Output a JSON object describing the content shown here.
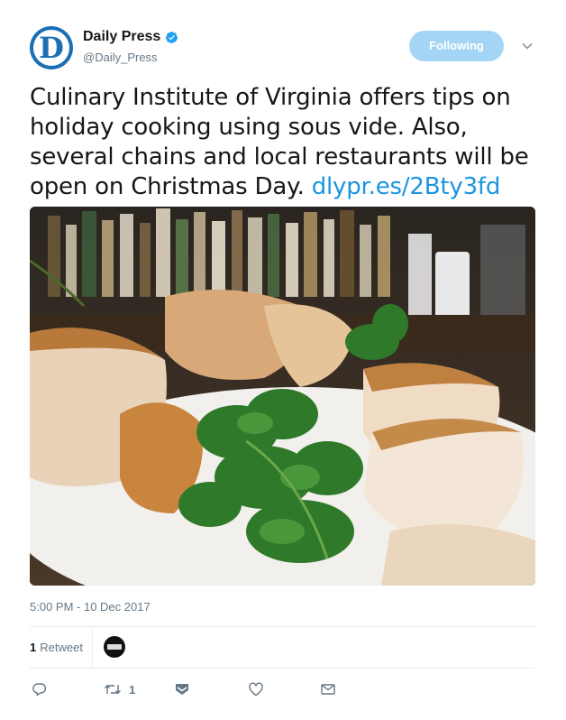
{
  "user": {
    "display_name": "Daily Press",
    "handle": "@Daily_Press",
    "avatar_letter": "D",
    "verified": true
  },
  "follow_button": {
    "label": "Following"
  },
  "tweet": {
    "text": "Culinary Institute of Virginia offers tips on holiday cooking using sous vide. Also, several chains and local restaurants will be open on Christmas Day.",
    "link": "dlypr.es/2Bty3fd",
    "timestamp": "5:00 PM - 10 Dec 2017"
  },
  "stats": {
    "retweet_count": "1",
    "retweet_label": "Retweet"
  },
  "actions": {
    "retweet_count": "1"
  },
  "colors": {
    "accent": "#1b95e0",
    "follow_bg": "#a5d5f6",
    "muted": "#657786",
    "avatar_blue": "#1b6fb3"
  },
  "icons": [
    "verified-icon",
    "chevron-down-icon",
    "reply-icon",
    "retweet-icon",
    "dm-icon",
    "like-icon",
    "mail-icon"
  ]
}
